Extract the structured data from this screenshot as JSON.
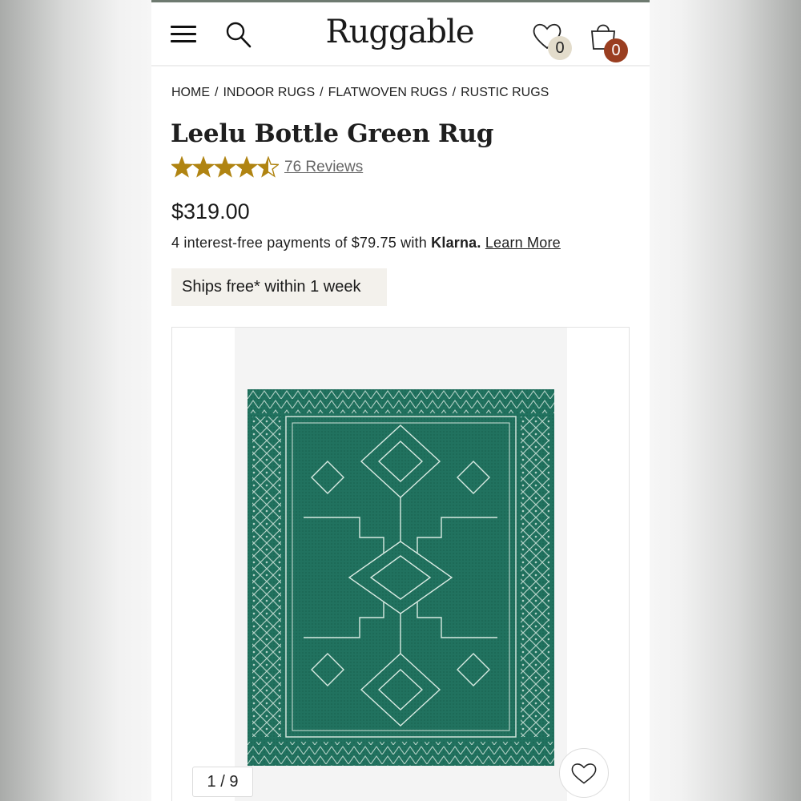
{
  "header": {
    "logo": "Ruggable",
    "wishlist_count": "0",
    "cart_count": "0",
    "icons": [
      "menu-icon",
      "search-icon",
      "heart-icon",
      "shopping-bag-icon"
    ]
  },
  "breadcrumb": [
    "HOME",
    "INDOOR RUGS",
    "FLATWOVEN RUGS",
    "RUSTIC RUGS"
  ],
  "breadcrumb_separator": "/",
  "product": {
    "title": "Leelu Bottle Green Rug",
    "rating": 4.5,
    "rating_max": 5,
    "reviews_label": "76 Reviews",
    "price": "$319.00",
    "klarna_prefix": "4 interest-free payments of $79.75 with",
    "klarna_brand": "Klarna.",
    "klarna_learn_more": "Learn More",
    "shipping": "Ships free* within 1 week"
  },
  "gallery": {
    "counter": "1 / 9"
  },
  "colors": {
    "star": "#b08412",
    "rug": "#21725f",
    "cart_badge": "#9a3e20",
    "wish_badge": "#e3dccb"
  }
}
